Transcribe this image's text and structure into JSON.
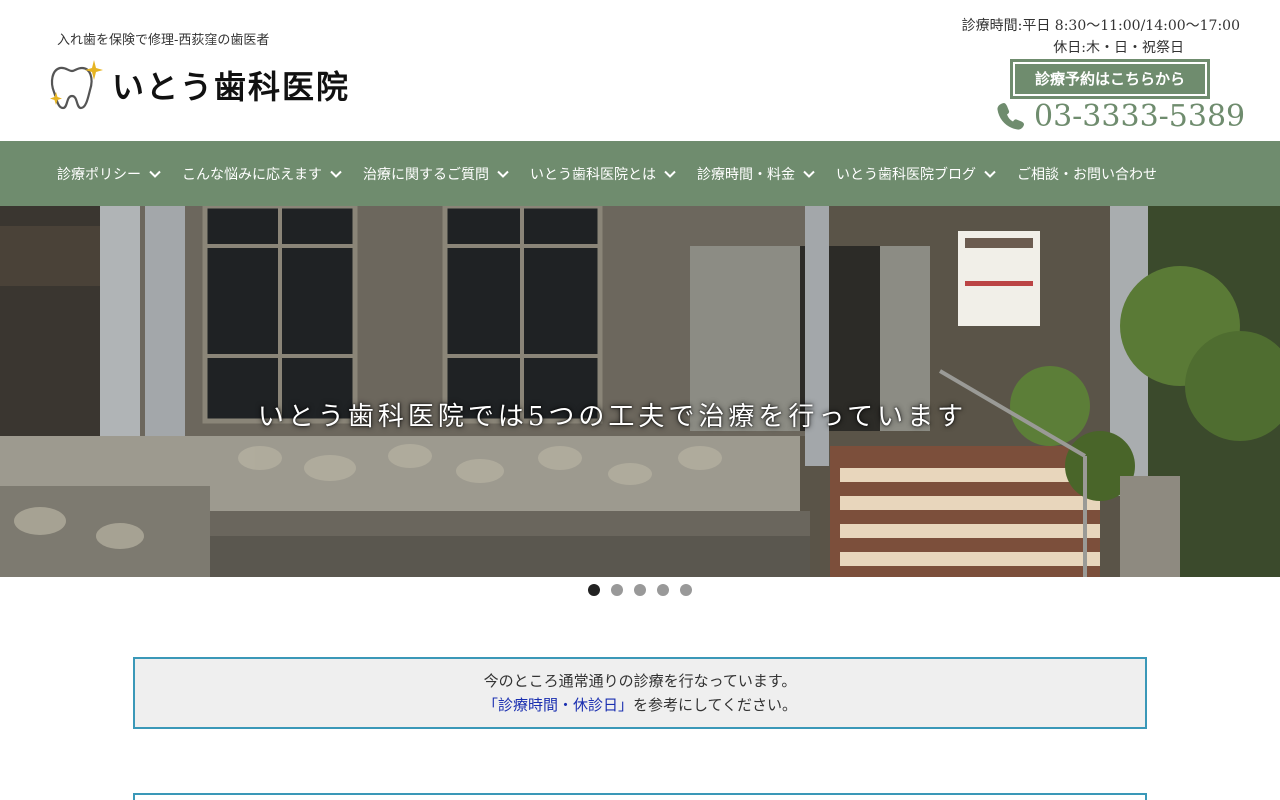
{
  "header": {
    "tagline": "入れ歯を保険で修理-西荻窪の歯医者",
    "logo_text": "いとう歯科医院",
    "hours_line1": "診療時間:平日 8:30〜11:00/14:00〜17:00",
    "hours_line2": "休日:木・日・祝祭日",
    "reserve_label": "診療予約はこちらから",
    "phone": "03-3333-5389",
    "brand_color": "#6f8c6e"
  },
  "nav": {
    "items": [
      {
        "label": "診療ポリシー",
        "icon": "chevron-down-icon"
      },
      {
        "label": "こんな悩みに応えます",
        "icon": "chevron-down-icon"
      },
      {
        "label": "治療に関するご質問",
        "icon": "chevron-down-icon"
      },
      {
        "label": "いとう歯科医院とは",
        "icon": "chevron-down-icon"
      },
      {
        "label": "診療時間・料金",
        "icon": "chevron-down-icon"
      },
      {
        "label": "いとう歯科医院ブログ",
        "icon": "chevron-down-icon"
      },
      {
        "label": "ご相談・お問い合わせ"
      }
    ]
  },
  "hero": {
    "caption": "いとう歯科医院では5つの工夫で治療を行っています",
    "slide_count": 5,
    "active_slide": 1
  },
  "notice": {
    "line1": "今のところ通常通りの診療を行なっています。",
    "link_text": "「診療時間・休診日」",
    "line2_suffix": "を参考にしてください。",
    "border_color": "#3a98b8"
  }
}
